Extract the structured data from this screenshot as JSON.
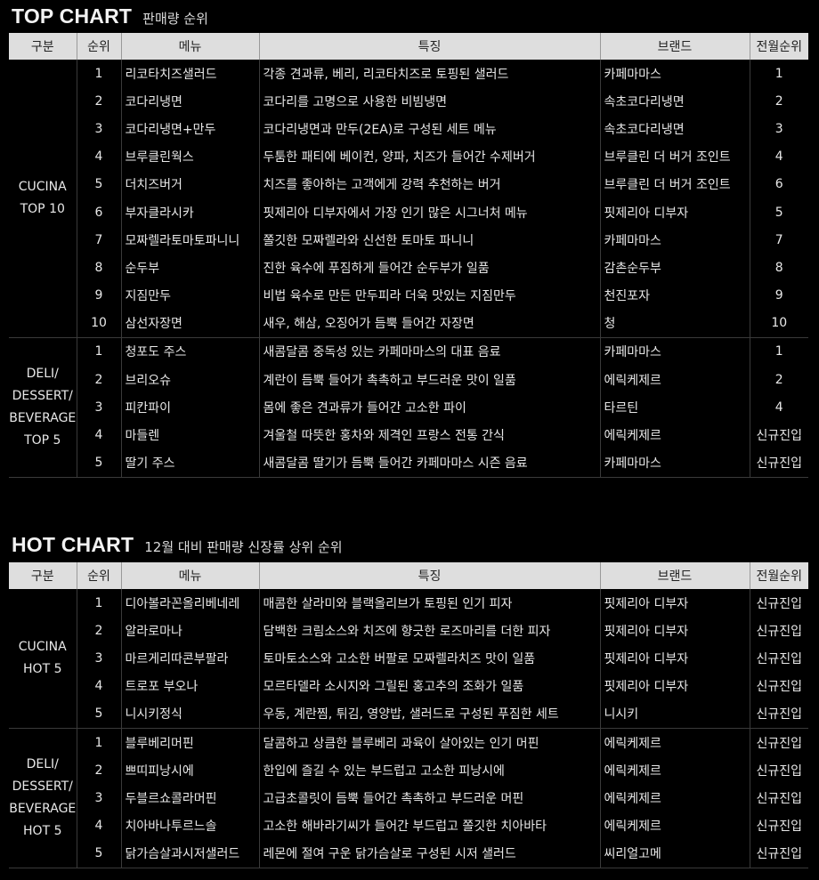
{
  "top_chart": {
    "title": "TOP CHART",
    "subtitle": "판매량 순위",
    "headers": [
      "구분",
      "순위",
      "메뉴",
      "특징",
      "브랜드",
      "전월순위"
    ],
    "groups": [
      {
        "label": "CUCINA\nTOP 10",
        "rows": [
          {
            "rank": "1",
            "menu": "리코타치즈샐러드",
            "feature": "각종 견과류, 베리, 리코타치즈로 토핑된 샐러드",
            "brand": "카페마마스",
            "prev": "1"
          },
          {
            "rank": "2",
            "menu": "코다리냉면",
            "feature": "코다리를 고명으로 사용한 비빔냉면",
            "brand": "속초코다리냉면",
            "prev": "2"
          },
          {
            "rank": "3",
            "menu": "코다리냉면+만두",
            "feature": "코다리냉면과 만두(2EA)로 구성된 세트 메뉴",
            "brand": "속초코다리냉면",
            "prev": "3"
          },
          {
            "rank": "4",
            "menu": "브루클린웍스",
            "feature": "두툼한 패티에 베이컨, 양파, 치즈가 들어간 수제버거",
            "brand": "브루클린 더 버거 조인트",
            "prev": "4"
          },
          {
            "rank": "5",
            "menu": "더치즈버거",
            "feature": "치즈를 좋아하는 고객에게 강력 추천하는 버거",
            "brand": "브루클린 더 버거 조인트",
            "prev": "6"
          },
          {
            "rank": "6",
            "menu": "부자클라시카",
            "feature": "핏제리아 디부자에서 가장 인기 많은 시그너처 메뉴",
            "brand": "핏제리아 디부자",
            "prev": "5"
          },
          {
            "rank": "7",
            "menu": "모짜렐라토마토파니니",
            "feature": "쫄깃한 모짜렐라와 신선한 토마토 파니니",
            "brand": "카페마마스",
            "prev": "7"
          },
          {
            "rank": "8",
            "menu": "순두부",
            "feature": "진한 육수에 푸짐하게 들어간 순두부가 일품",
            "brand": "감촌순두부",
            "prev": "8"
          },
          {
            "rank": "9",
            "menu": "지짐만두",
            "feature": "비법 육수로 만든 만두피라 더욱 맛있는 지짐만두",
            "brand": "천진포자",
            "prev": "9"
          },
          {
            "rank": "10",
            "menu": "삼선자장면",
            "feature": "새우, 해삼, 오징어가 듬뿍 들어간 자장면",
            "brand": "청",
            "prev": "10"
          }
        ]
      },
      {
        "label": "DELI/\nDESSERT/\nBEVERAGE\nTOP 5",
        "rows": [
          {
            "rank": "1",
            "menu": "청포도 주스",
            "feature": "새콤달콤 중독성 있는 카페마마스의 대표 음료",
            "brand": "카페마마스",
            "prev": "1"
          },
          {
            "rank": "2",
            "menu": "브리오슈",
            "feature": "계란이 듬뿍 들어가 촉촉하고 부드러운 맛이 일품",
            "brand": "에릭케제르",
            "prev": "2"
          },
          {
            "rank": "3",
            "menu": "피칸파이",
            "feature": "몸에 좋은 견과류가 들어간 고소한 파이",
            "brand": "타르틴",
            "prev": "4"
          },
          {
            "rank": "4",
            "menu": "마들렌",
            "feature": "겨울철 따뜻한 홍차와 제격인 프랑스 전통 간식",
            "brand": "에릭케제르",
            "prev": "신규진입"
          },
          {
            "rank": "5",
            "menu": "딸기 주스",
            "feature": "새콤달콤 딸기가 듬뿍 들어간 카페마마스 시즌 음료",
            "brand": "카페마마스",
            "prev": "신규진입"
          }
        ]
      }
    ]
  },
  "hot_chart": {
    "title": "HOT CHART",
    "subtitle": "12월 대비 판매량 신장률 상위 순위",
    "headers": [
      "구분",
      "순위",
      "메뉴",
      "특징",
      "브랜드",
      "전월순위"
    ],
    "groups": [
      {
        "label": "CUCINA\nHOT 5",
        "rows": [
          {
            "rank": "1",
            "menu": "디아볼라꼰올리베네레",
            "feature": "매콤한 살라미와 블랙올리브가 토핑된 인기 피자",
            "brand": "핏제리아 디부자",
            "prev": "신규진입"
          },
          {
            "rank": "2",
            "menu": "알라로마나",
            "feature": "담백한 크림소스와 치즈에 향긋한 로즈마리를 더한 피자",
            "brand": "핏제리아 디부자",
            "prev": "신규진입"
          },
          {
            "rank": "3",
            "menu": "마르게리따콘부팔라",
            "feature": "토마토소스와 고소한 버팔로 모짜렐라치즈 맛이 일품",
            "brand": "핏제리아 디부자",
            "prev": "신규진입"
          },
          {
            "rank": "4",
            "menu": "트로포 부오나",
            "feature": "모르타델라 소시지와 그릴된 홍고추의 조화가 일품",
            "brand": "핏제리아 디부자",
            "prev": "신규진입"
          },
          {
            "rank": "5",
            "menu": "니시키정식",
            "feature": "우동, 계란찜, 튀김, 영양밥, 샐러드로 구성된 푸짐한 세트",
            "brand": "니시키",
            "prev": "신규진입"
          }
        ]
      },
      {
        "label": "DELI/\nDESSERT/\nBEVERAGE\nHOT 5",
        "rows": [
          {
            "rank": "1",
            "menu": "블루베리머핀",
            "feature": "달콤하고 상큼한 블루베리 과육이 살아있는 인기 머핀",
            "brand": "에릭케제르",
            "prev": "신규진입"
          },
          {
            "rank": "2",
            "menu": "쁘띠피낭시에",
            "feature": "한입에 즐길 수 있는 부드럽고 고소한 피낭시에",
            "brand": "에릭케제르",
            "prev": "신규진입"
          },
          {
            "rank": "3",
            "menu": "두블르쇼콜라머핀",
            "feature": "고급초콜릿이 듬뿍 들어간 촉촉하고 부드러운 머핀",
            "brand": "에릭케제르",
            "prev": "신규진입"
          },
          {
            "rank": "4",
            "menu": "치아바나투르느솔",
            "feature": "고소한 해바라기씨가 들어간 부드럽고 쫄깃한 치아바타",
            "brand": "에릭케제르",
            "prev": "신규진입"
          },
          {
            "rank": "5",
            "menu": "닭가슴살과시저샐러드",
            "feature": "레몬에 절여 구운 닭가슴살로 구성된 시저 샐러드",
            "brand": "씨리얼고메",
            "prev": "신규진입"
          }
        ]
      }
    ]
  }
}
